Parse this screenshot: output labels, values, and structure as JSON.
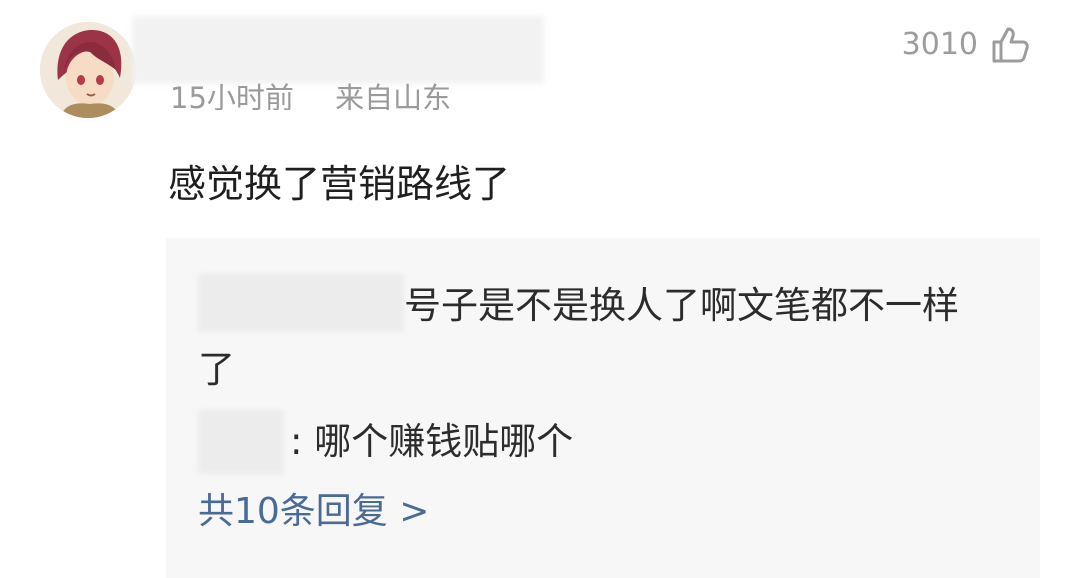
{
  "comment": {
    "meta": {
      "time": "15小时前",
      "location": "来自山东"
    },
    "likes": {
      "count": "3010",
      "icon": "thumbs-up-icon"
    },
    "text": "感觉换了营销路线了"
  },
  "replies": {
    "items": [
      {
        "text": "号子是不是换人了啊文笔都不一样了"
      },
      {
        "separator": ":",
        "text": " 哪个赚钱贴哪个"
      }
    ],
    "more_label": "共10条回复 >"
  },
  "colors": {
    "meta_gray": "#9a9a9a",
    "link_blue": "#4a6b95",
    "reply_bg": "#f7f7f7"
  }
}
